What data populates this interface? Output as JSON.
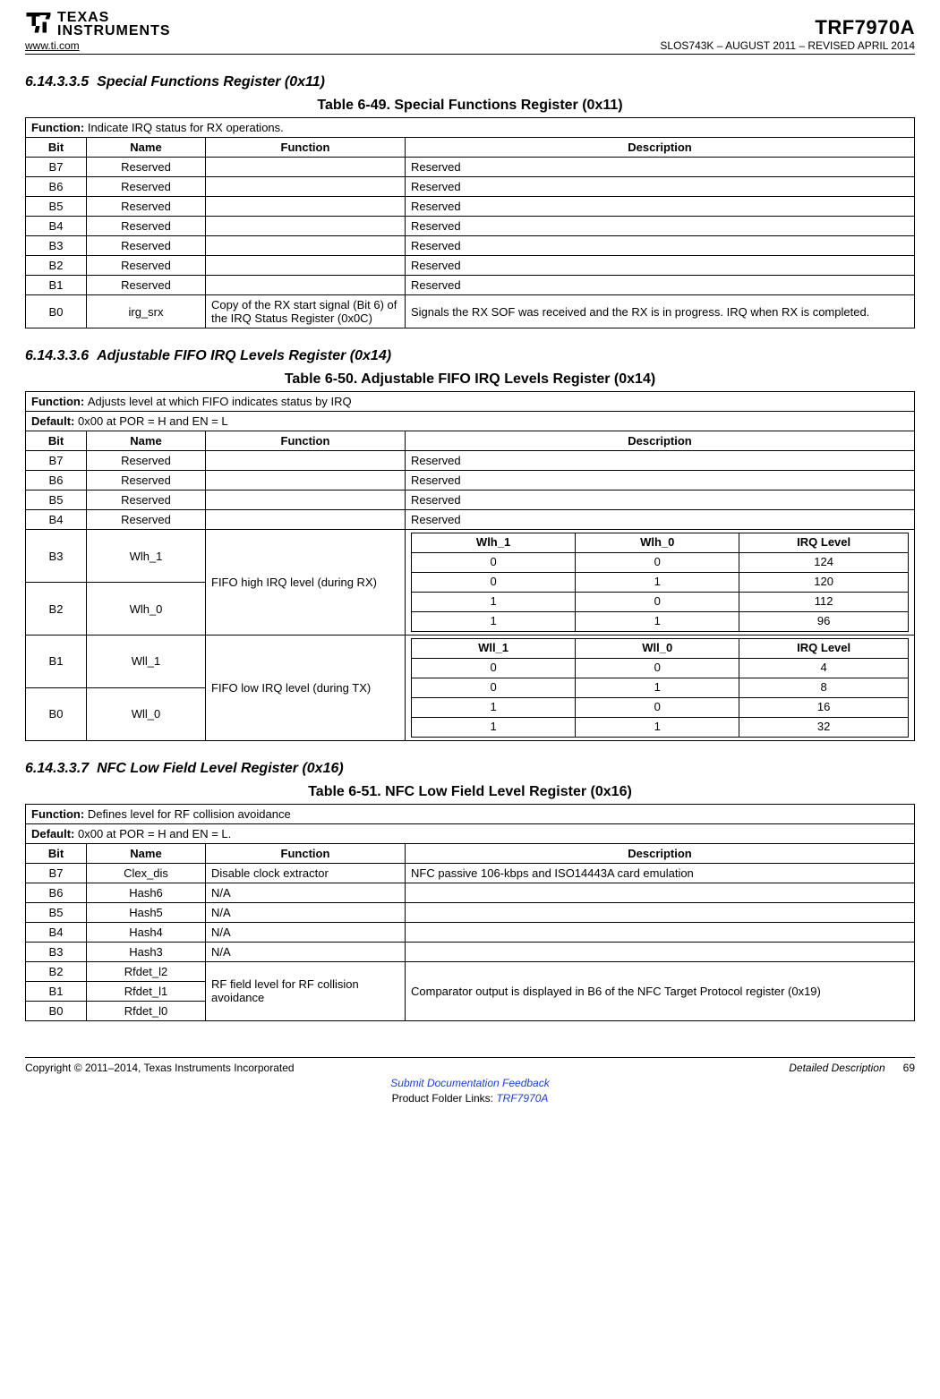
{
  "header": {
    "url": "www.ti.com",
    "logo_text_top": "TEXAS",
    "logo_text_bottom": "INSTRUMENTS",
    "part": "TRF7970A",
    "doc_rev": "SLOS743K – AUGUST 2011 – REVISED APRIL 2014"
  },
  "sections": {
    "s1": {
      "num": "6.14.3.3.5",
      "title": "Special Functions Register (0x11)",
      "caption": "Table 6-49. Special Functions Register (0x11)",
      "func": "Indicate IRQ status for RX operations.",
      "cols": {
        "bit": "Bit",
        "name": "Name",
        "function": "Function",
        "desc": "Description"
      },
      "rows": [
        {
          "bit": "B7",
          "name": "Reserved",
          "func": "",
          "desc": "Reserved"
        },
        {
          "bit": "B6",
          "name": "Reserved",
          "func": "",
          "desc": "Reserved"
        },
        {
          "bit": "B5",
          "name": "Reserved",
          "func": "",
          "desc": "Reserved"
        },
        {
          "bit": "B4",
          "name": "Reserved",
          "func": "",
          "desc": "Reserved"
        },
        {
          "bit": "B3",
          "name": "Reserved",
          "func": "",
          "desc": "Reserved"
        },
        {
          "bit": "B2",
          "name": "Reserved",
          "func": "",
          "desc": "Reserved"
        },
        {
          "bit": "B1",
          "name": "Reserved",
          "func": "",
          "desc": "Reserved"
        },
        {
          "bit": "B0",
          "name": "irg_srx",
          "func": "Copy of the RX start signal (Bit 6) of the IRQ Status Register (0x0C)",
          "desc": "Signals the RX SOF was received and the RX is in progress. IRQ when RX is completed."
        }
      ]
    },
    "s2": {
      "num": "6.14.3.3.6",
      "title": "Adjustable FIFO IRQ Levels Register (0x14)",
      "caption": "Table 6-50. Adjustable FIFO IRQ Levels Register (0x14)",
      "func": "Adjusts level at which FIFO indicates status by IRQ",
      "deflt": "0x00 at POR = H and EN = L",
      "cols": {
        "bit": "Bit",
        "name": "Name",
        "function": "Function",
        "desc": "Description"
      },
      "reserved": [
        {
          "bit": "B7",
          "name": "Reserved",
          "desc": "Reserved"
        },
        {
          "bit": "B6",
          "name": "Reserved",
          "desc": "Reserved"
        },
        {
          "bit": "B5",
          "name": "Reserved",
          "desc": "Reserved"
        },
        {
          "bit": "B4",
          "name": "Reserved",
          "desc": "Reserved"
        }
      ],
      "group_high": {
        "b3": {
          "bit": "B3",
          "name": "Wlh_1"
        },
        "b2": {
          "bit": "B2",
          "name": "Wlh_0"
        },
        "func": "FIFO high IRQ level (during RX)",
        "tt": {
          "h1": "Wlh_1",
          "h2": "Wlh_0",
          "h3": "IRQ Level",
          "rows": [
            [
              "0",
              "0",
              "124"
            ],
            [
              "0",
              "1",
              "120"
            ],
            [
              "1",
              "0",
              "112"
            ],
            [
              "1",
              "1",
              "96"
            ]
          ]
        }
      },
      "group_low": {
        "b1": {
          "bit": "B1",
          "name": "Wll_1"
        },
        "b0": {
          "bit": "B0",
          "name": "Wll_0"
        },
        "func": "FIFO low IRQ level (during TX)",
        "tt": {
          "h1": "Wll_1",
          "h2": "Wll_0",
          "h3": "IRQ Level",
          "rows": [
            [
              "0",
              "0",
              "4"
            ],
            [
              "0",
              "1",
              "8"
            ],
            [
              "1",
              "0",
              "16"
            ],
            [
              "1",
              "1",
              "32"
            ]
          ]
        }
      }
    },
    "s3": {
      "num": "6.14.3.3.7",
      "title": "NFC Low Field Level Register (0x16)",
      "caption": "Table 6-51. NFC Low Field Level Register (0x16)",
      "func": "Defines level for RF collision avoidance",
      "deflt": "0x00 at POR = H and EN = L.",
      "cols": {
        "bit": "Bit",
        "name": "Name",
        "function": "Function",
        "desc": "Description"
      },
      "rows_top": [
        {
          "bit": "B7",
          "name": "Clex_dis",
          "func": "Disable clock extractor",
          "desc": "NFC passive 106-kbps and ISO14443A card emulation"
        },
        {
          "bit": "B6",
          "name": "Hash6",
          "func": "N/A",
          "desc": ""
        },
        {
          "bit": "B5",
          "name": "Hash5",
          "func": "N/A",
          "desc": ""
        },
        {
          "bit": "B4",
          "name": "Hash4",
          "func": "N/A",
          "desc": ""
        },
        {
          "bit": "B3",
          "name": "Hash3",
          "func": "N/A",
          "desc": ""
        }
      ],
      "group_rfdet": {
        "bits": [
          {
            "bit": "B2",
            "name": "Rfdet_l2"
          },
          {
            "bit": "B1",
            "name": "Rfdet_l1"
          },
          {
            "bit": "B0",
            "name": "Rfdet_l0"
          }
        ],
        "func": "RF field level for RF collision avoidance",
        "desc": "Comparator output is displayed in B6 of the NFC Target Protocol register (0x19)"
      }
    }
  },
  "footer": {
    "copyright": "Copyright © 2011–2014, Texas Instruments Incorporated",
    "section_label": "Detailed Description",
    "page": "69",
    "feedback": "Submit Documentation Feedback",
    "folder_prefix": "Product Folder Links: ",
    "folder_link": "TRF7970A"
  },
  "labels": {
    "function_prefix": "Function: ",
    "default_prefix": "Default: "
  }
}
